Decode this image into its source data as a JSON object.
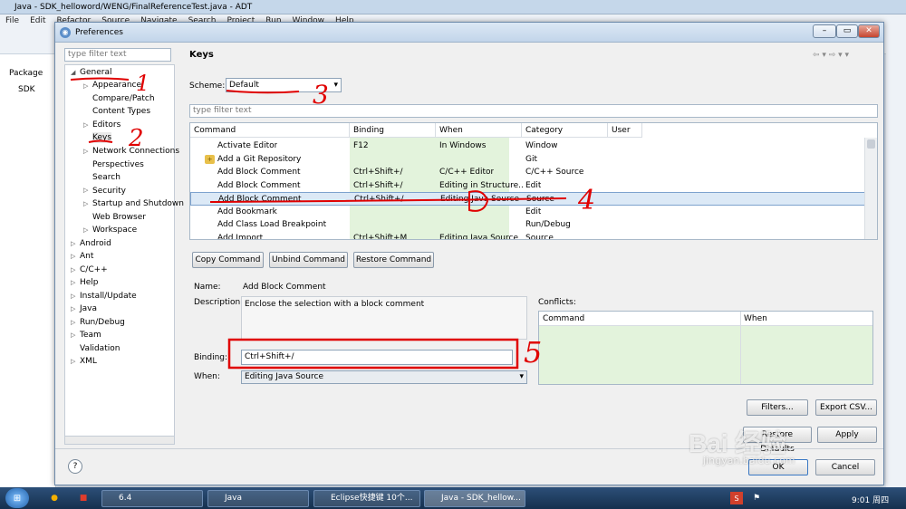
{
  "ide": {
    "title": "Java - SDK_helloword/WENG/FinalReferenceTest.java - ADT",
    "menu": [
      "File",
      "Edit",
      "Refactor",
      "Source",
      "Navigate",
      "Search",
      "Project",
      "Run",
      "Window",
      "Help"
    ],
    "left_tab": "Package",
    "left_root": "SDK"
  },
  "dialog": {
    "title": "Preferences",
    "filter_placeholder": "type filter text",
    "tree": {
      "general": "General",
      "general_children": [
        "Appearance",
        "Compare/Patch",
        "Content Types",
        "Editors",
        "Keys",
        "Network Connections",
        "Perspectives",
        "Search",
        "Security",
        "Startup and Shutdown",
        "Web Browser",
        "Workspace"
      ],
      "top_level": [
        "Android",
        "Ant",
        "C/C++",
        "Help",
        "Install/Update",
        "Java",
        "Run/Debug",
        "Team",
        "Validation",
        "XML"
      ]
    },
    "keys": {
      "title": "Keys",
      "scheme_label": "Scheme:",
      "scheme_value": "Default",
      "filter_placeholder": "type filter text",
      "columns": [
        "Command",
        "Binding",
        "When",
        "Category",
        "User"
      ],
      "rows": [
        {
          "command": "Activate Editor",
          "binding": "F12",
          "when": "In Windows",
          "category": "Window",
          "user": ""
        },
        {
          "command": "Add a Git Repository",
          "binding": "",
          "when": "",
          "category": "Git",
          "user": ""
        },
        {
          "command": "Add Block Comment",
          "binding": "Ctrl+Shift+/",
          "when": "C/C++ Editor",
          "category": "C/C++ Source",
          "user": ""
        },
        {
          "command": "Add Block Comment",
          "binding": "Ctrl+Shift+/",
          "when": "Editing in Structure...",
          "category": "Edit",
          "user": ""
        },
        {
          "command": "Add Block Comment",
          "binding": "Ctrl+Shift+/",
          "when": "Editing Java Source",
          "category": "Source",
          "user": ""
        },
        {
          "command": "Add Bookmark",
          "binding": "",
          "when": "",
          "category": "Edit",
          "user": ""
        },
        {
          "command": "Add Class Load Breakpoint",
          "binding": "",
          "when": "",
          "category": "Run/Debug",
          "user": ""
        },
        {
          "command": "Add Import",
          "binding": "Ctrl+Shift+M",
          "when": "Editing Java Source",
          "category": "Source",
          "user": ""
        }
      ],
      "copy_command": "Copy Command",
      "unbind_command": "Unbind Command",
      "restore_command": "Restore Command",
      "name_label": "Name:",
      "name_value": "Add Block Comment",
      "description_label": "Description:",
      "description_value": "Enclose the selection with a block comment",
      "binding_label": "Binding:",
      "binding_value": "Ctrl+Shift+/",
      "when_label": "When:",
      "when_value": "Editing Java Source",
      "conflicts_label": "Conflicts:",
      "conflict_columns": [
        "Command",
        "When"
      ],
      "filters_button": "Filters...",
      "export_button": "Export CSV...",
      "restore_defaults": "Restore Defaults",
      "apply": "Apply"
    },
    "ok": "OK",
    "cancel": "Cancel"
  },
  "annotations": [
    "1",
    "2",
    "3",
    "4",
    "5"
  ],
  "watermark": {
    "brand": "Bai 经验",
    "url": "jingyan.baidu.com"
  },
  "taskbar": {
    "items": [
      "6.4",
      "Java",
      "Eclipse快捷键 10个...",
      "Java - SDK_hellow..."
    ],
    "time": "9:01 周四"
  },
  "colors": {
    "selected_row": "#dce9f6",
    "green_cells": "#e3f3dc",
    "annotation": "#e00000"
  }
}
